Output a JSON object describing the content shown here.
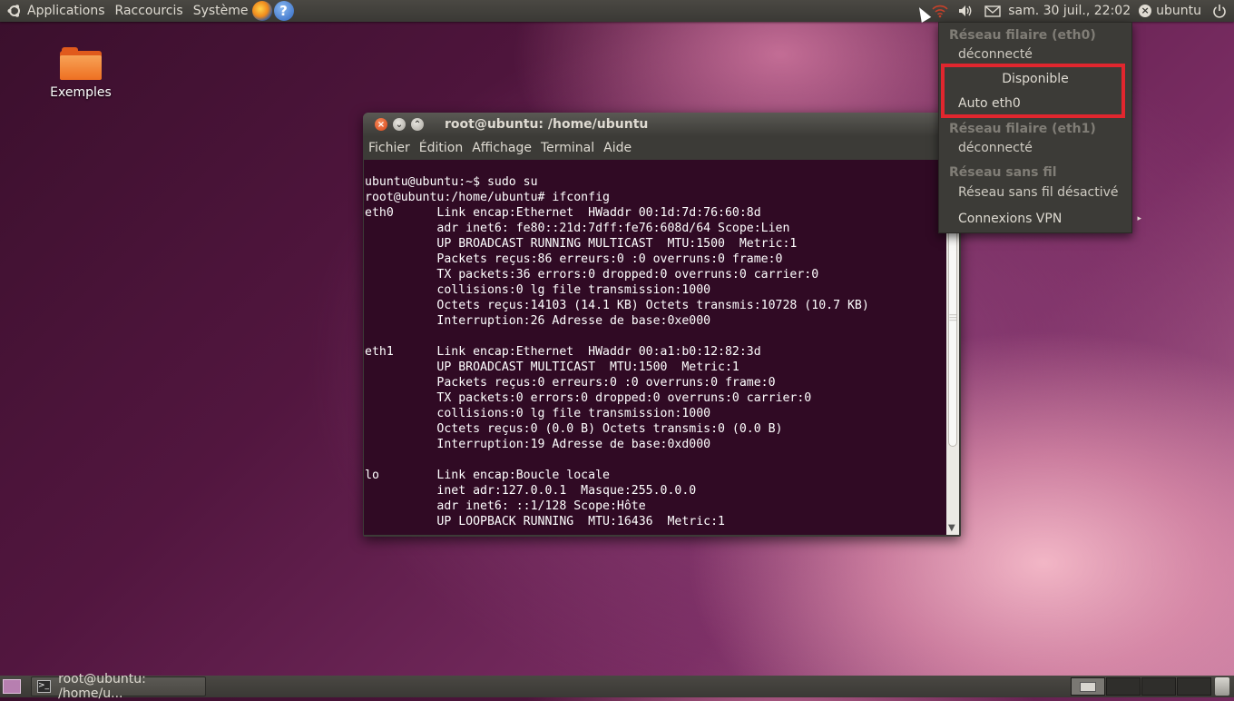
{
  "top_panel": {
    "menus": [
      "Applications",
      "Raccourcis",
      "Système"
    ],
    "launchers": [
      {
        "icon": "firefox-icon"
      },
      {
        "icon": "help-icon",
        "glyph": "?"
      }
    ],
    "clock": "sam. 30 juil., 22:02",
    "user": "ubuntu",
    "tray_icons": [
      "network-wireless-icon",
      "volume-icon",
      "mail-icon",
      "user-status-icon",
      "power-icon"
    ]
  },
  "desktop": {
    "icons": [
      {
        "label": "Exemples",
        "icon": "folder-icon"
      }
    ]
  },
  "terminal": {
    "title": "root@ubuntu: /home/ubuntu",
    "menu": [
      "Fichier",
      "Édition",
      "Affichage",
      "Terminal",
      "Aide"
    ],
    "lines": [
      "ubuntu@ubuntu:~$ sudo su",
      "root@ubuntu:/home/ubuntu# ifconfig",
      "eth0      Link encap:Ethernet  HWaddr 00:1d:7d:76:60:8d",
      "          adr inet6: fe80::21d:7dff:fe76:608d/64 Scope:Lien",
      "          UP BROADCAST RUNNING MULTICAST  MTU:1500  Metric:1",
      "          Packets reçus:86 erreurs:0 :0 overruns:0 frame:0",
      "          TX packets:36 errors:0 dropped:0 overruns:0 carrier:0",
      "          collisions:0 lg file transmission:1000",
      "          Octets reçus:14103 (14.1 KB) Octets transmis:10728 (10.7 KB)",
      "          Interruption:26 Adresse de base:0xe000",
      "",
      "eth1      Link encap:Ethernet  HWaddr 00:a1:b0:12:82:3d",
      "          UP BROADCAST MULTICAST  MTU:1500  Metric:1",
      "          Packets reçus:0 erreurs:0 :0 overruns:0 frame:0",
      "          TX packets:0 errors:0 dropped:0 overruns:0 carrier:0",
      "          collisions:0 lg file transmission:1000",
      "          Octets reçus:0 (0.0 B) Octets transmis:0 (0.0 B)",
      "          Interruption:19 Adresse de base:0xd000",
      "",
      "lo        Link encap:Boucle locale",
      "          inet adr:127.0.0.1  Masque:255.0.0.0",
      "          adr inet6: ::1/128 Scope:Hôte",
      "          UP LOOPBACK RUNNING  MTU:16436  Metric:1"
    ]
  },
  "network_menu": {
    "wired_eth0_header": "Réseau filaire (eth0)",
    "wired_eth0_status": "déconnecté",
    "available_label": "Disponible",
    "auto_eth0": "Auto eth0",
    "wired_eth1_header": "Réseau filaire (eth1)",
    "wired_eth1_status": "déconnecté",
    "wireless_header": "Réseau sans fil",
    "wireless_status": "Réseau sans fil désactivé",
    "vpn": "Connexions VPN",
    "highlight_color": "#e1262e"
  },
  "bottom_panel": {
    "task_label": "root@ubuntu: /home/u..."
  }
}
